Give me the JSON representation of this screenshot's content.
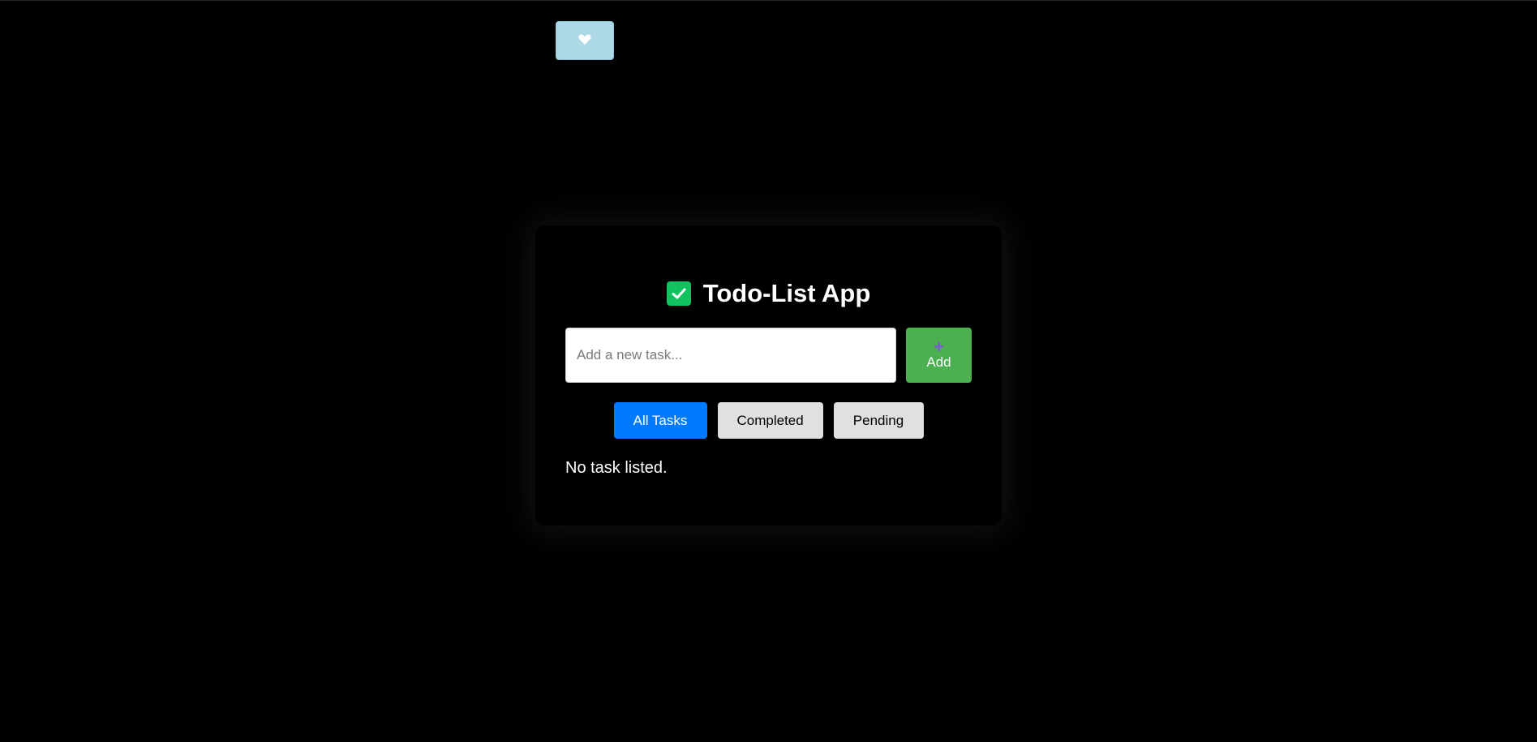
{
  "theme_toggle": {
    "icon": "heart-icon"
  },
  "app": {
    "title": "Todo-List App",
    "title_icon": "check-square-icon"
  },
  "task_input": {
    "value": "",
    "placeholder": "Add a new task..."
  },
  "add_button": {
    "icon": "plus-icon",
    "icon_glyph": "+",
    "label": "Add"
  },
  "filters": {
    "all": "All Tasks",
    "completed": "Completed",
    "pending": "Pending",
    "selected": "All Tasks"
  },
  "tasks": {
    "items": [],
    "empty_message": "No task listed."
  },
  "colors": {
    "background": "#000000",
    "add_button": "#4caf50",
    "active_filter": "#007bff",
    "inactive_filter": "#e0e0e0",
    "theme_toggle": "#add8e6",
    "check_icon": "#12c25f"
  }
}
